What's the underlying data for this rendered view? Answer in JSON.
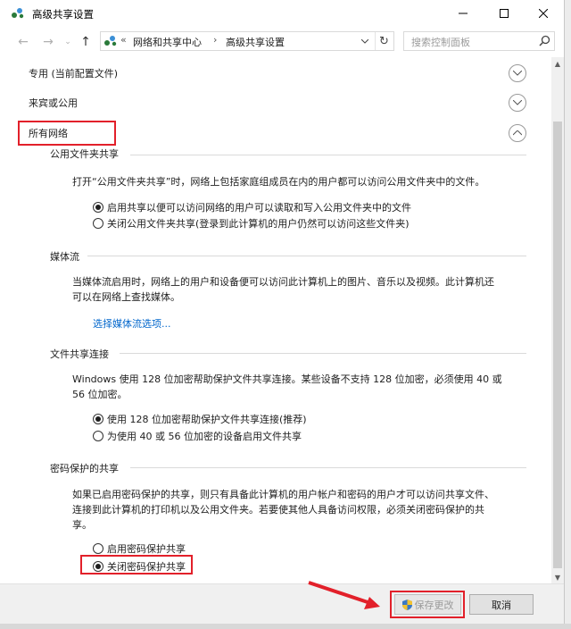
{
  "window": {
    "title": "高级共享设置"
  },
  "address": {
    "overflow": "«",
    "crumbs": [
      "网络和共享中心",
      "高级共享设置"
    ]
  },
  "search": {
    "placeholder": "搜索控制面板"
  },
  "categories": [
    {
      "label": "专用 (当前配置文件)",
      "state": "collapsed"
    },
    {
      "label": "来宾或公用",
      "state": "collapsed"
    },
    {
      "label": "所有网络",
      "state": "expanded"
    }
  ],
  "sections": {
    "public_folder": {
      "title": "公用文件夹共享",
      "description": "打开“公用文件夹共享”时，网络上包括家庭组成员在内的用户都可以访问公用文件夹中的文件。",
      "options": [
        {
          "label": "启用共享以便可以访问网络的用户可以读取和写入公用文件夹中的文件",
          "selected": true
        },
        {
          "label": "关闭公用文件夹共享(登录到此计算机的用户仍然可以访问这些文件夹)",
          "selected": false
        }
      ]
    },
    "media": {
      "title": "媒体流",
      "description_line1": "当媒体流启用时，网络上的用户和设备便可以访问此计算机上的图片、音乐以及视频。此计算机还",
      "description_line2": "可以在网络上查找媒体。",
      "link": "选择媒体流选项..."
    },
    "file_sharing": {
      "title": "文件共享连接",
      "description_line1": "Windows 使用 128 位加密帮助保护文件共享连接。某些设备不支持 128 位加密，必须使用 40 或",
      "description_line2": "56 位加密。",
      "options": [
        {
          "label": "使用 128 位加密帮助保护文件共享连接(推荐)",
          "selected": true
        },
        {
          "label": "为使用 40 或 56 位加密的设备启用文件共享",
          "selected": false
        }
      ]
    },
    "password": {
      "title": "密码保护的共享",
      "description_line1": "如果已启用密码保护的共享，则只有具备此计算机的用户帐户和密码的用户才可以访问共享文件、",
      "description_line2": "连接到此计算机的打印机以及公用文件夹。若要使其他人具备访问权限，必须关闭密码保护的共",
      "description_line3": "享。",
      "options": [
        {
          "label": "启用密码保护共享",
          "selected": false
        },
        {
          "label": "关闭密码保护共享",
          "selected": true
        }
      ]
    }
  },
  "footer": {
    "save_label": "保存更改",
    "cancel_label": "取消"
  },
  "colors": {
    "accent_red": "#e2202a",
    "link": "#0066cc",
    "footer_bg": "#f0f0f0"
  }
}
